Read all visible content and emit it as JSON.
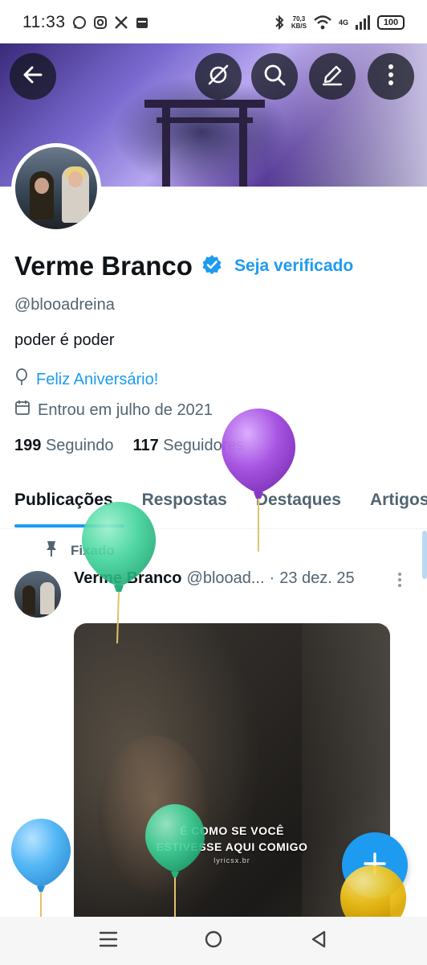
{
  "status_bar": {
    "time": "11:33",
    "net_speed_value": "70,3",
    "net_speed_unit": "KB/S",
    "network_gen": "4G",
    "battery": "100"
  },
  "banner": {
    "back_icon": "arrow-left-icon",
    "grok_icon": "grok-icon",
    "search_icon": "search-icon",
    "edit_icon": "edit-icon",
    "more_icon": "more-vertical-icon"
  },
  "profile": {
    "display_name": "Verme Branco",
    "verify_link": "Seja verificado",
    "handle": "@blooadreina",
    "bio": "poder é poder",
    "birthday": "Feliz Aniversário!",
    "joined": "Entrou em julho de 2021",
    "following_count": "199",
    "following_label": "Seguindo",
    "followers_count": "117",
    "followers_label": "Seguidores"
  },
  "tabs": [
    {
      "label": "Publicações",
      "active": true
    },
    {
      "label": "Respostas",
      "active": false
    },
    {
      "label": "Destaques",
      "active": false
    },
    {
      "label": "Artigos",
      "active": false
    }
  ],
  "post": {
    "pinned_label": "Fixado",
    "author_name": "Verme Branco",
    "author_handle": "@blooad...",
    "separator": "·",
    "date": "23 dez. 25",
    "media_caption_line1": "É COMO SE VOCÊ",
    "media_caption_line2": "ESTIVESSE AQUI COMIGO",
    "media_caption_credit": "lyricsx.br"
  },
  "colors": {
    "accent": "#1d9bf0",
    "text_primary": "#0f1419",
    "text_secondary": "#536471",
    "balloon_purple": "#a24ae0",
    "balloon_green": "#3ed39a",
    "balloon_blue": "#4ab3f5",
    "balloon_yellow": "#f5c518"
  },
  "nav": {
    "recents_icon": "menu-lines-icon",
    "home_icon": "circle-home-icon",
    "back_icon": "triangle-back-icon"
  }
}
